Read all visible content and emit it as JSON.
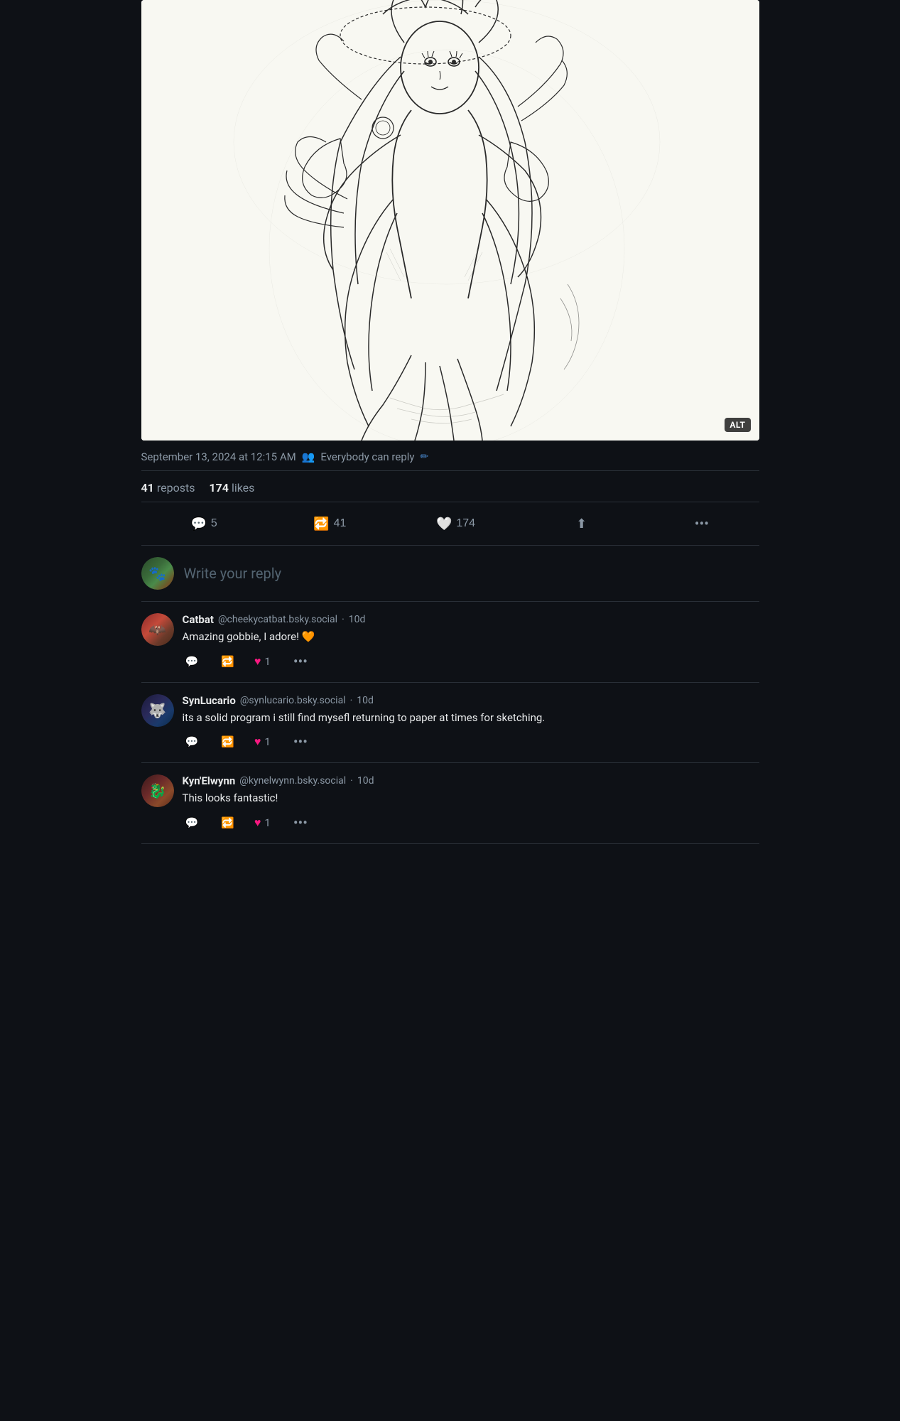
{
  "image": {
    "alt_label": "ALT",
    "description": "Pencil sketch of an anime-style character"
  },
  "post_meta": {
    "date": "September 13, 2024 at 12:15 AM",
    "audience_icon": "👥",
    "audience_label": "Everybody can reply",
    "edit_icon": "✏"
  },
  "stats": {
    "reposts_count": "41",
    "reposts_label": "reposts",
    "likes_count": "174",
    "likes_label": "likes"
  },
  "actions": {
    "reply_count": "5",
    "repost_count": "41",
    "like_count": "174",
    "share_label": "Share",
    "more_label": "More"
  },
  "reply_compose": {
    "placeholder": "Write your reply"
  },
  "comments": [
    {
      "id": "catbat",
      "author": "Catbat",
      "handle": "@cheekycatbat.bsky.social",
      "time": "10d",
      "text": "Amazing gobbie, I adore! 🧡",
      "likes": "1"
    },
    {
      "id": "synlucario",
      "author": "SynLucario",
      "handle": "@synlucario.bsky.social",
      "time": "10d",
      "text": "its a solid program i still find mysefl returning to paper at times for sketching.",
      "likes": "1"
    },
    {
      "id": "kynelwynn",
      "author": "Kyn'Elwynn",
      "handle": "@kynelwynn.bsky.social",
      "time": "10d",
      "text": "This looks fantastic!",
      "likes": "1"
    }
  ]
}
